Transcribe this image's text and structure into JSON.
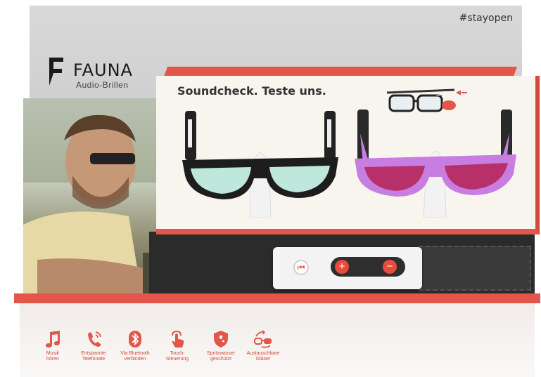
{
  "header": {
    "hashtag": "#stayopen"
  },
  "brand": {
    "name": "FAUNA",
    "subtitle": "Audio-Brillen"
  },
  "display": {
    "headline": "Soundcheck. Teste uns."
  },
  "colors": {
    "accent": "#e2574a",
    "panel": "#d4d4d4",
    "lens_mint": "#bfe8dc",
    "frame_purple": "#c77ee0",
    "lens_magenta": "#b8306a"
  },
  "remote": {
    "buttons": [
      {
        "icon": "skip-icon"
      },
      {
        "icon": "plus-icon",
        "label": "+"
      },
      {
        "icon": "minus-icon",
        "label": "−"
      }
    ]
  },
  "features": [
    {
      "icon": "music-note-icon",
      "label": "Musik\nhören"
    },
    {
      "icon": "phone-icon",
      "label": "Entspannte\nTelefonate"
    },
    {
      "icon": "bluetooth-icon",
      "label": "Via Bluetooth\nverbinden"
    },
    {
      "icon": "touch-icon",
      "label": "Touch-\nSteuerung"
    },
    {
      "icon": "shield-icon",
      "label": "Spritzwasser\ngeschützt"
    },
    {
      "icon": "swap-lenses-icon",
      "label": "Austauschbare\nGläser"
    }
  ]
}
